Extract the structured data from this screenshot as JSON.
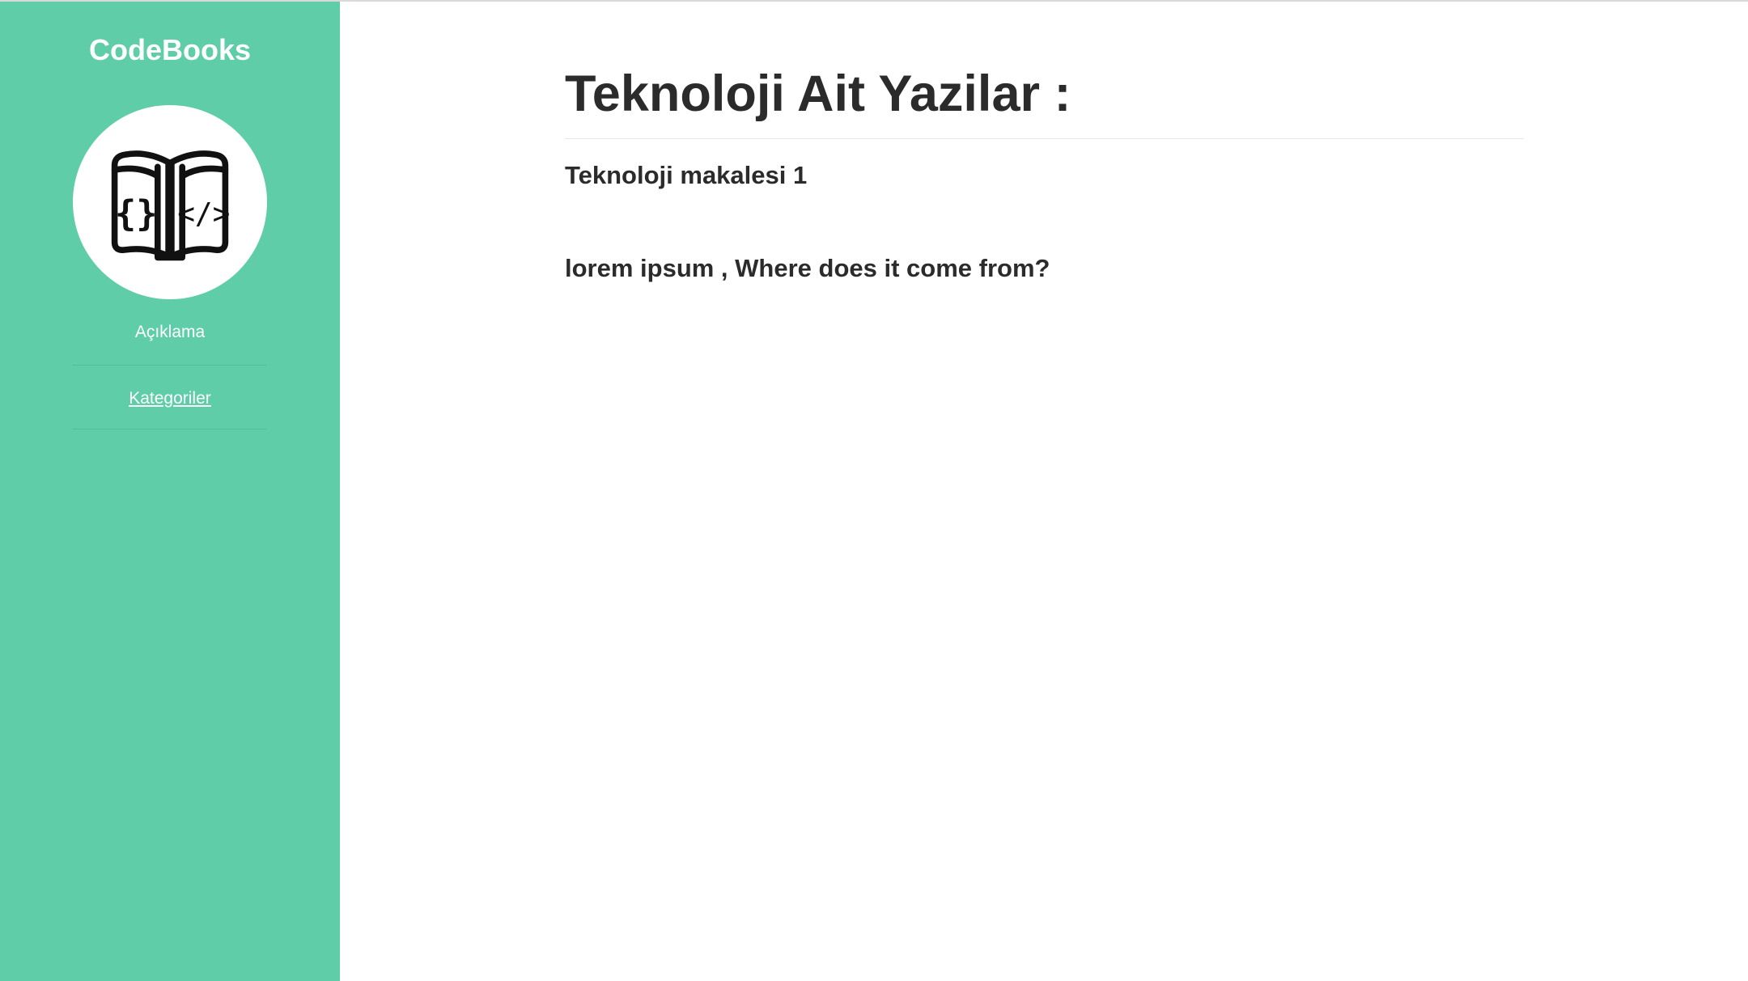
{
  "sidebar": {
    "brand": "CodeBooks",
    "logo_icon": "open-book-code-icon",
    "description": "Açıklama",
    "nav": {
      "categories_label": "Kategoriler"
    },
    "background_color": "#5ecda8"
  },
  "main": {
    "page_title": "Teknoloji Ait Yazilar :",
    "article": {
      "title": "Teknoloji makalesi 1",
      "subtitle": "lorem ipsum , Where does it come from?"
    }
  }
}
